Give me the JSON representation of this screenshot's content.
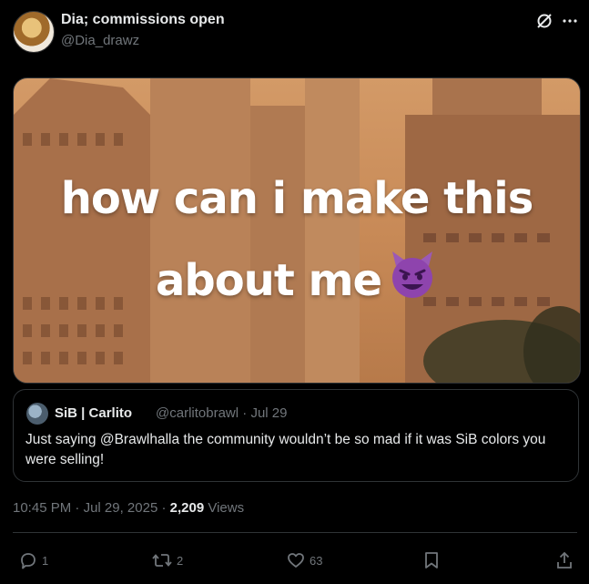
{
  "author": {
    "display_name": "Dia; commissions open",
    "handle": "@Dia_drawz"
  },
  "top_icons": [
    "grok-icon",
    "more-icon"
  ],
  "media": {
    "caption_line1": "how can i make this",
    "caption_line2": "about me",
    "emoji": "smiling-devil-emoji"
  },
  "quoted_tweet": {
    "display_name": "SiB | Carlito",
    "handle": "@carlitobrawl",
    "date": "Jul 29",
    "text": "Just saying @Brawlhalla the community wouldn’t be so mad if it was SiB colors you were selling!"
  },
  "meta": {
    "time": "10:45 PM",
    "date": "Jul 29, 2025",
    "views_count": "2,209",
    "views_label": "Views"
  },
  "actions": {
    "replies": "1",
    "reposts": "2",
    "likes": "63"
  },
  "colors": {
    "background": "#000000",
    "text": "#e7e9ea",
    "secondary": "#71767b",
    "border": "#2f3336",
    "devil": "#8e44ad"
  }
}
